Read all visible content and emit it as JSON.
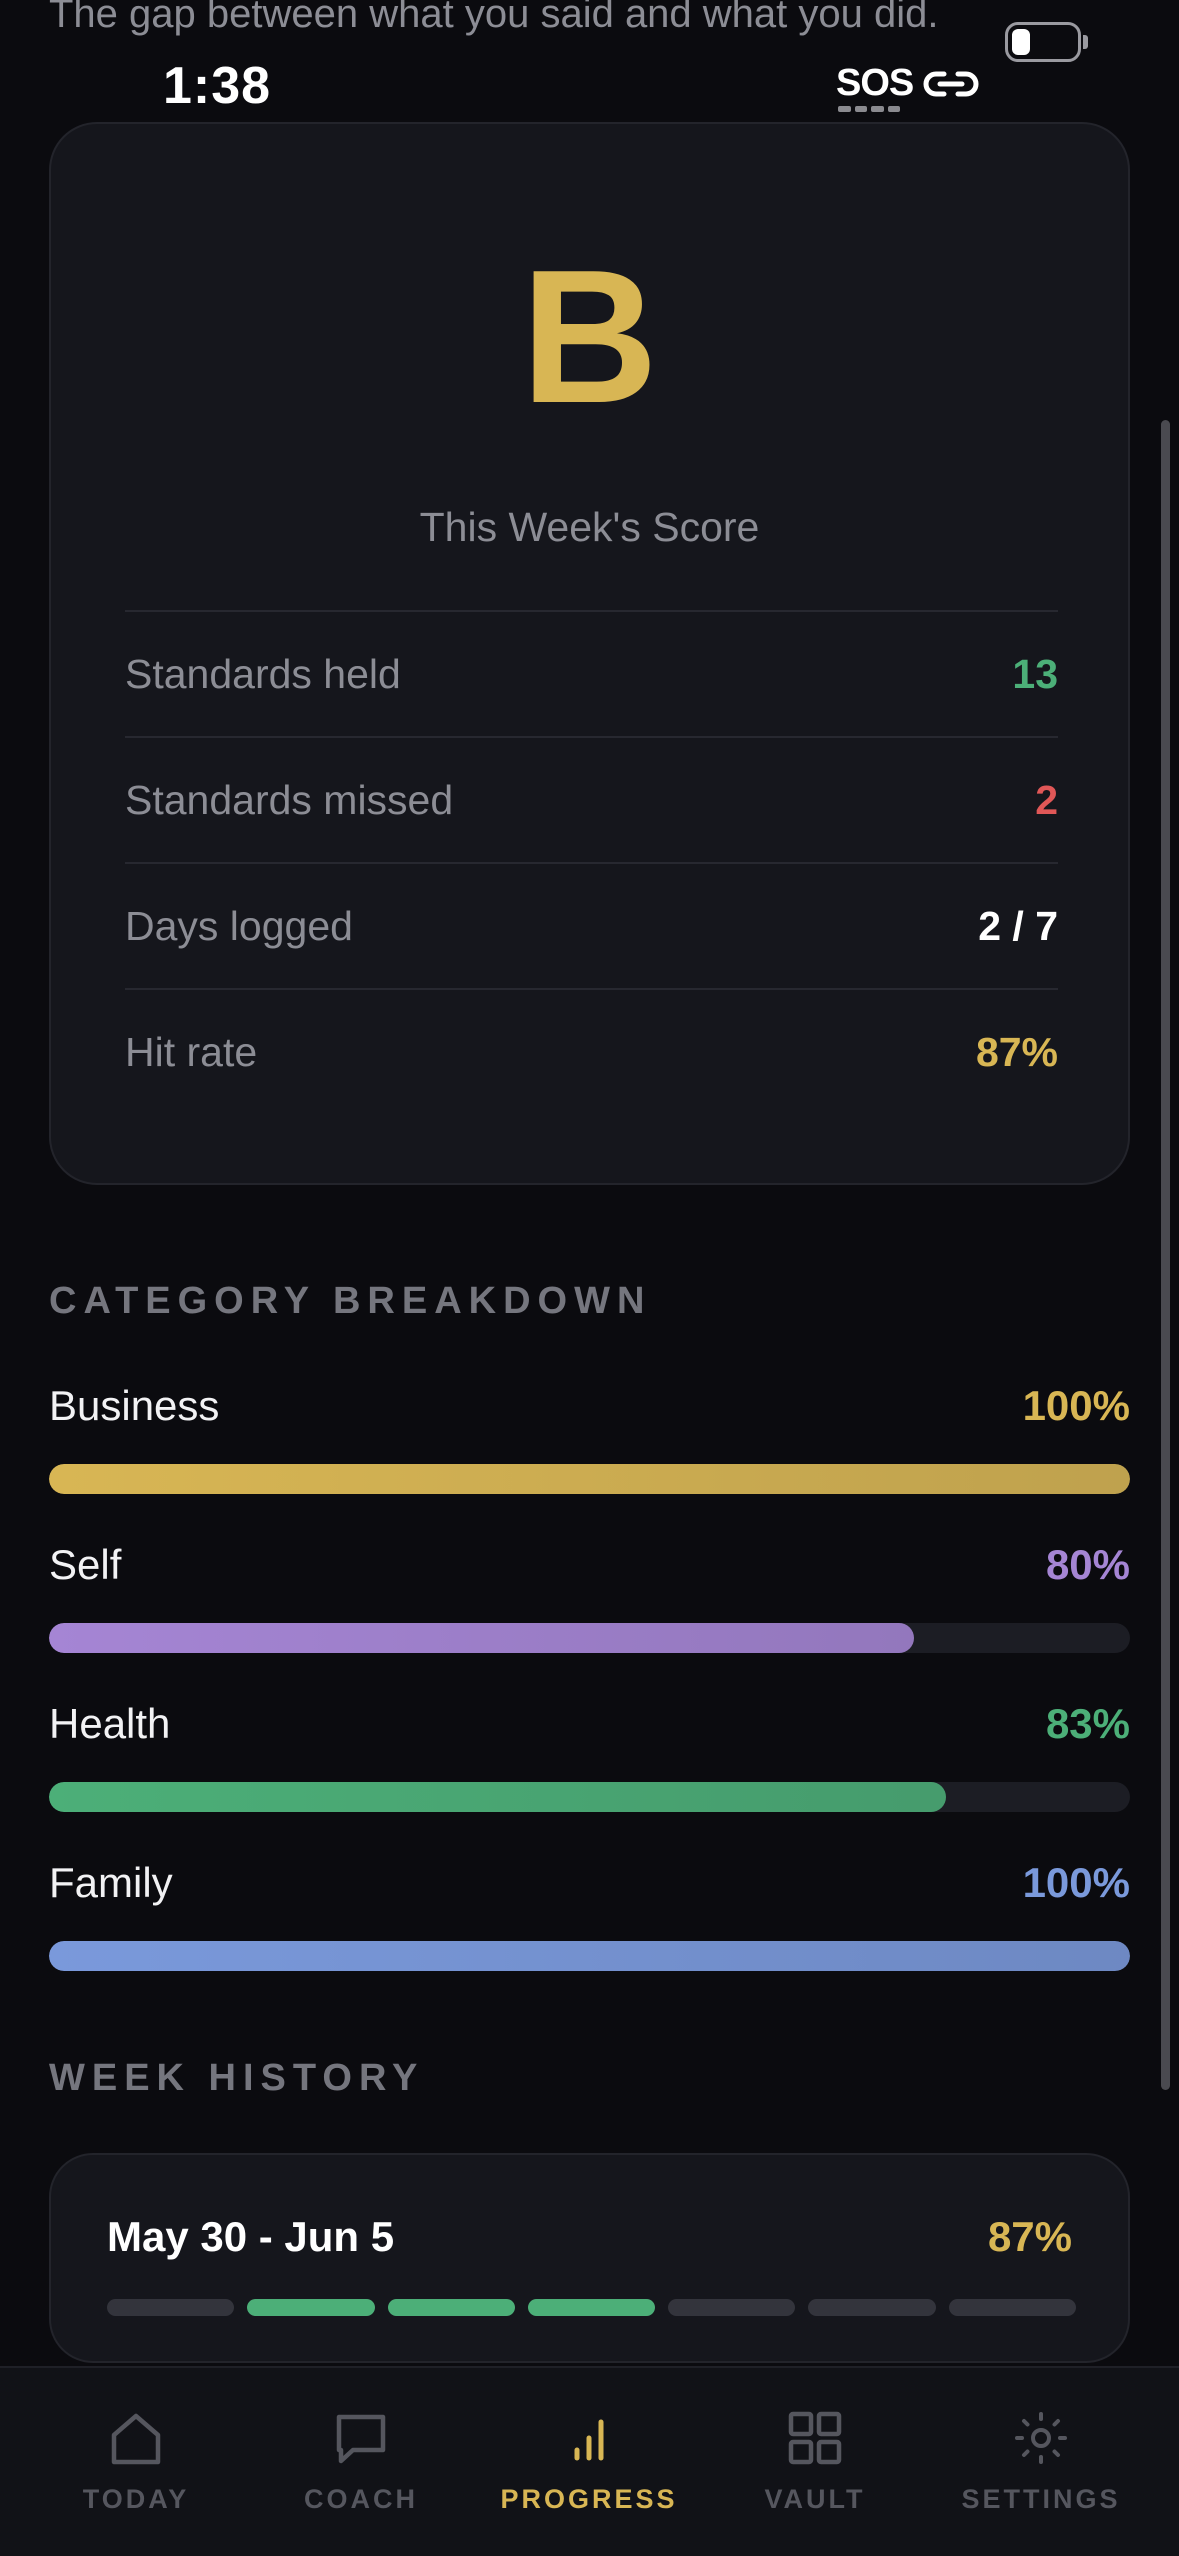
{
  "header": {
    "subtitle": "The gap between what you said and what you did."
  },
  "status_bar": {
    "time": "1:38",
    "sos": "SOS",
    "battery_level": 0.2
  },
  "score": {
    "grade": "B",
    "label": "This Week's Score",
    "stats": [
      {
        "name": "Standards held",
        "value": "13",
        "color": "#4caf78"
      },
      {
        "name": "Standards missed",
        "value": "2",
        "color": "#e05757"
      },
      {
        "name": "Days logged",
        "value": "2 / 7",
        "color": "#ffffff"
      },
      {
        "name": "Hit rate",
        "value": "87%",
        "color": "#d8b654"
      }
    ]
  },
  "category_breakdown": {
    "title": "CATEGORY BREAKDOWN",
    "items": [
      {
        "name": "Business",
        "percent_label": "100%",
        "percent": 100,
        "color": "#d8b654"
      },
      {
        "name": "Self",
        "percent_label": "80%",
        "percent": 80,
        "color": "#a585d4"
      },
      {
        "name": "Health",
        "percent_label": "83%",
        "percent": 83,
        "color": "#4caf78"
      },
      {
        "name": "Family",
        "percent_label": "100%",
        "percent": 100,
        "color": "#7a99db"
      }
    ]
  },
  "week_history": {
    "title": "WEEK HISTORY",
    "weeks": [
      {
        "range": "May 30 - Jun 5",
        "percent": "87%",
        "days": [
          "empty",
          "hit",
          "hit",
          "hit",
          "empty",
          "empty",
          "empty"
        ]
      }
    ]
  },
  "colors": {
    "accent": "#d8b654",
    "hit": "#4caf78",
    "empty": "#33343c",
    "inactive": "#55565e"
  },
  "tabbar": {
    "active": "progress",
    "tabs": [
      {
        "id": "today",
        "label": "TODAY",
        "icon": "home-icon"
      },
      {
        "id": "coach",
        "label": "COACH",
        "icon": "chat-bubble-icon"
      },
      {
        "id": "progress",
        "label": "PROGRESS",
        "icon": "bar-chart-icon"
      },
      {
        "id": "vault",
        "label": "VAULT",
        "icon": "grid-icon"
      },
      {
        "id": "settings",
        "label": "SETTINGS",
        "icon": "gear-icon"
      }
    ]
  }
}
